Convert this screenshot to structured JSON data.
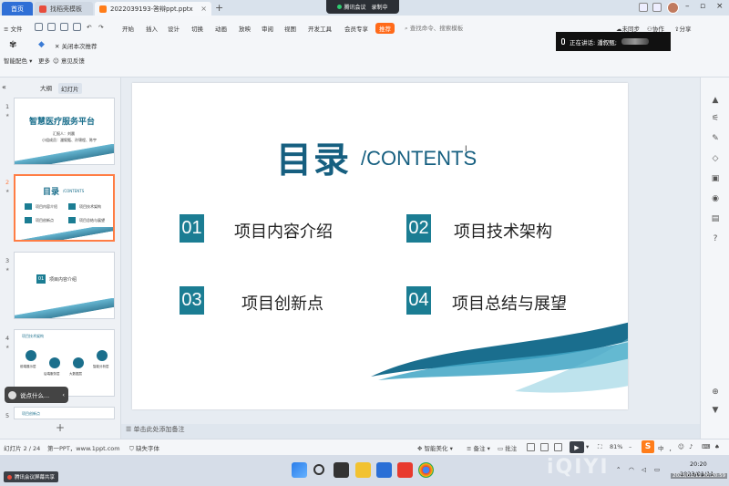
{
  "titlebar": {
    "tabs": [
      {
        "label": "首页"
      },
      {
        "label": "找稻壳模板"
      },
      {
        "label": "2022039193-答辩ppt.pptx"
      }
    ],
    "meeting": {
      "name": "腾讯会议",
      "status": "录制中"
    }
  },
  "ribbon": {
    "quick_file": "文件",
    "menus": [
      "开始",
      "插入",
      "设计",
      "切换",
      "动画",
      "放映",
      "审阅",
      "视图",
      "开发工具",
      "会员专享",
      "推荐"
    ],
    "search_placeholder": "查找命令、搜索模板",
    "right_tools": [
      "未同步",
      "协作",
      "分享"
    ],
    "sub": {
      "smart_color": "智能配色",
      "more": "更多",
      "close_recommend": "关闭本次推荐",
      "feedback": "意见反馈"
    }
  },
  "speaker": {
    "label": "正在讲话: 潘叙甄;"
  },
  "left_panel": {
    "tabs": [
      "大纲",
      "幻灯片"
    ],
    "slides": [
      {
        "num": "1",
        "title": "智慧医疗服务平台",
        "small": "汇报人：刘晨",
        "small2": "小组成员：潘叙甄、孙锦程、陈宇"
      },
      {
        "num": "2",
        "title": "目录",
        "sub": "/CONTENTS",
        "items": [
          "项目内容介绍",
          "项目技术架构",
          "项目创新点",
          "项目总结与展望"
        ]
      },
      {
        "num": "3",
        "title": "项目内容介绍",
        "badge": "01"
      },
      {
        "num": "4",
        "title": "项目技术架构",
        "nodes": [
          "前端展示层",
          "后端服务层",
          "大数据层",
          "智能分析层"
        ]
      },
      {
        "num": "5",
        "title": "项目创新点"
      }
    ],
    "chat_bubble": "说点什么..."
  },
  "slide": {
    "title": "目录",
    "subtitle": "/CONTENTS",
    "items": [
      {
        "num": "01",
        "text": "项目内容介绍"
      },
      {
        "num": "02",
        "text": "项目技术架构"
      },
      {
        "num": "03",
        "text": "项目创新点"
      },
      {
        "num": "04",
        "text": "项目总结与展望"
      }
    ]
  },
  "notes_placeholder": "单击此处添加备注",
  "status": {
    "slide_counter": "幻灯片 2 / 24",
    "theme": "第一PPT，www.1ppt.com",
    "missing_font": "缺失字体",
    "beautify": "智能美化",
    "notes": "备注",
    "comments": "批注",
    "zoom": "81%",
    "ime": [
      "中",
      "，"
    ]
  },
  "taskbar": {
    "shared_notice": "腾讯会议屏幕共享",
    "time": "20:20",
    "date": "2023/01/11",
    "stamp": "2023/01/11 20:20:59"
  },
  "colors": {
    "accent": "#165f80",
    "badge": "#1b7d93",
    "ribbon_highlight": "#ff6a1a",
    "home_tab": "#2f6fd6"
  }
}
